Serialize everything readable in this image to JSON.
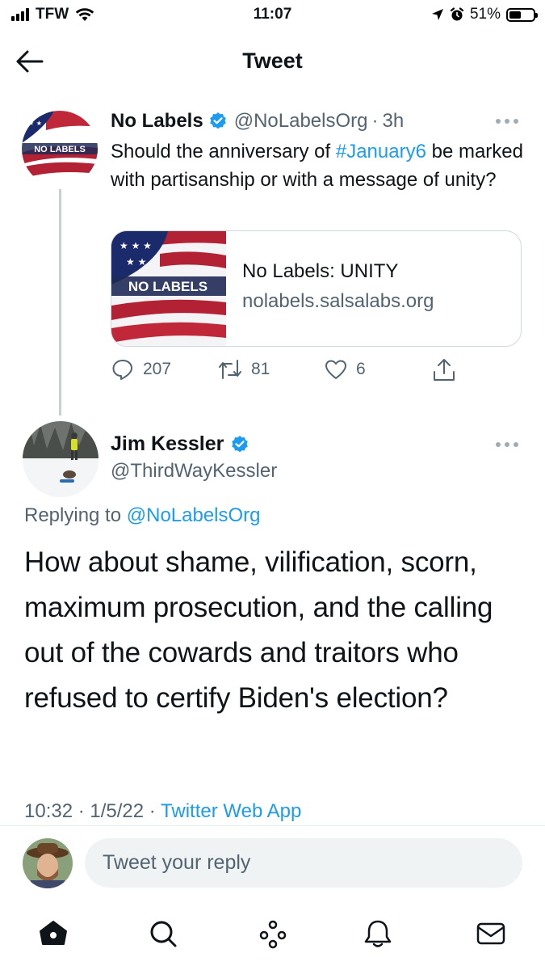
{
  "status_bar": {
    "carrier": "TFW",
    "time": "11:07",
    "battery_percent": "51%",
    "battery_level": 0.51,
    "icons": [
      "signal-icon",
      "wifi-icon",
      "location-icon",
      "alarm-icon",
      "battery-icon"
    ]
  },
  "header": {
    "title": "Tweet",
    "back_icon": "back-arrow-icon"
  },
  "original_tweet": {
    "author_name": "No Labels",
    "handle": "@NoLabelsOrg",
    "separator": "·",
    "time_ago": "3h",
    "avatar_text": "NO LABELS",
    "text_before": "Should the anniversary of ",
    "hashtag": "#January6",
    "text_after": " be marked with partisanship or with a message of unity?",
    "card": {
      "image_text": "NO LABELS",
      "title": "No Labels: UNITY",
      "domain": "nolabels.salsalabs.org"
    },
    "actions": {
      "replies": "207",
      "retweets": "81",
      "likes": "6"
    }
  },
  "reply_tweet": {
    "author_name": "Jim Kessler",
    "handle": "@ThirdWayKessler",
    "replying_prefix": "Replying to ",
    "replying_to": "@NoLabelsOrg",
    "text": "How about shame, vilification, scorn, maximum prosecution, and the calling out of the cowards and traitors who refused to certify Biden's election?",
    "time": "10:32",
    "date": "1/5/22",
    "sep": " · ",
    "source": "Twitter Web App"
  },
  "composer": {
    "placeholder": "Tweet your reply"
  },
  "bottom_nav": {
    "items": [
      "home-icon",
      "search-icon",
      "spaces-icon",
      "notifications-icon",
      "messages-icon"
    ]
  },
  "colors": {
    "accent": "#1d9bf0",
    "muted": "#536471",
    "border": "#cfd9de",
    "thread_line": "#c4cfd6",
    "flag_red": "#b22234",
    "flag_blue": "#1b2a6b"
  }
}
